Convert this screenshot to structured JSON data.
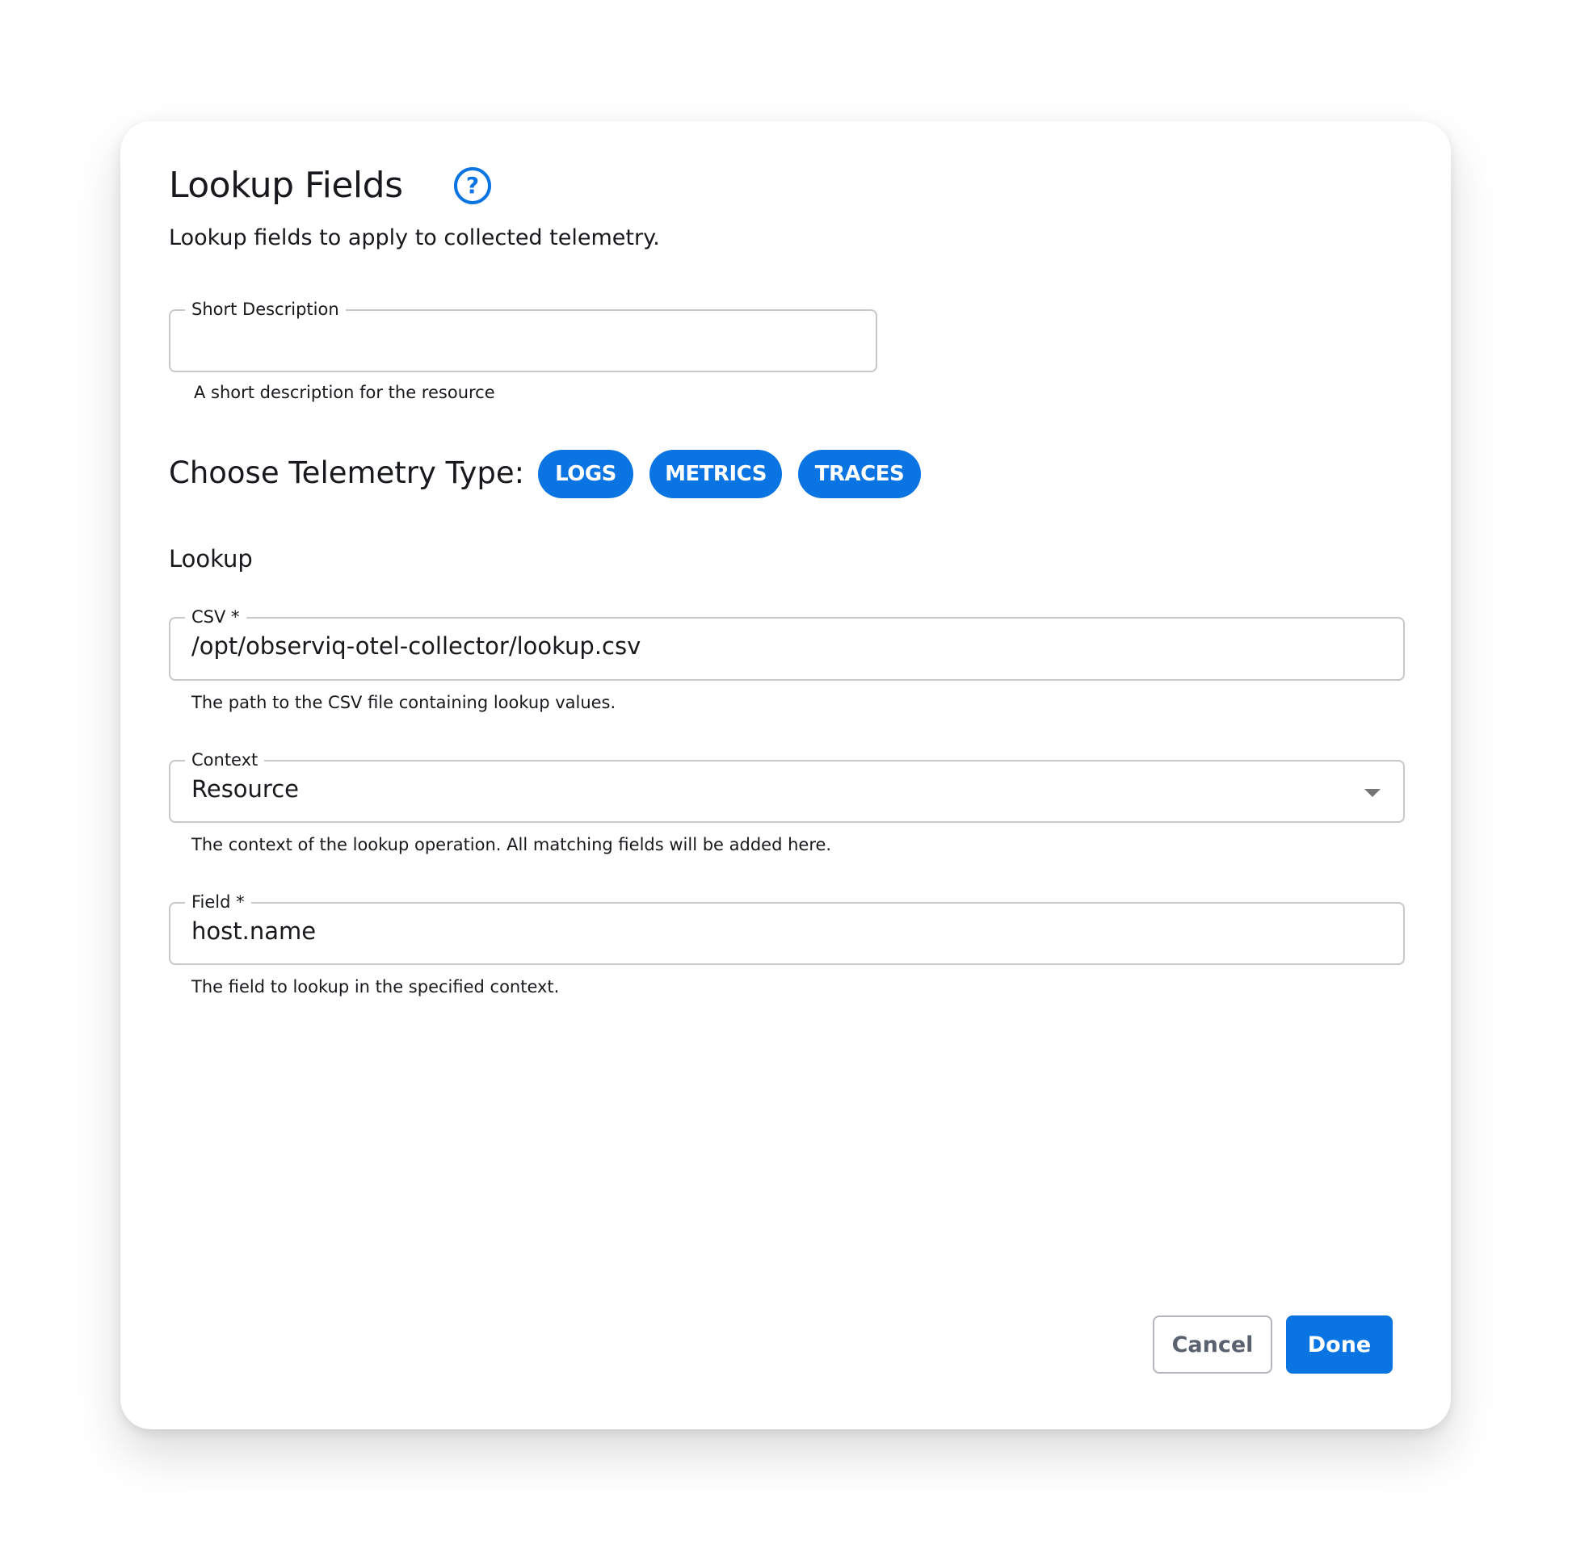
{
  "dialog": {
    "title": "Lookup Fields",
    "help_icon": "help-circle-icon",
    "subtitle": "Lookup fields to apply to collected telemetry."
  },
  "short_description": {
    "label": "Short Description",
    "value": "",
    "helper": "A short description for the resource"
  },
  "telemetry": {
    "label": "Choose Telemetry Type:",
    "chips": [
      {
        "label": "LOGS",
        "selected": true
      },
      {
        "label": "METRICS",
        "selected": true
      },
      {
        "label": "TRACES",
        "selected": true
      }
    ],
    "accent_color": "#0a74e3"
  },
  "lookup": {
    "heading": "Lookup",
    "csv": {
      "label": "CSV *",
      "value": "/opt/observiq-otel-collector/lookup.csv",
      "helper": "The path to the CSV file containing lookup values."
    },
    "context": {
      "label": "Context",
      "value": "Resource",
      "helper": "The context of the lookup operation. All matching fields will be added here.",
      "icon": "chevron-down-icon"
    },
    "field": {
      "label": "Field *",
      "value": "host.name",
      "helper": "The field to lookup in the specified context."
    }
  },
  "actions": {
    "cancel_label": "Cancel",
    "done_label": "Done"
  }
}
